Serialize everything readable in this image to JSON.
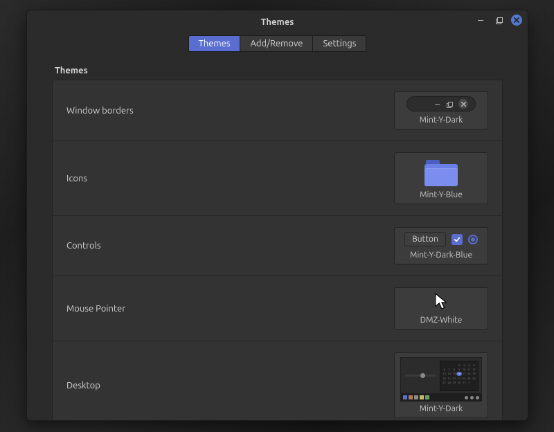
{
  "window": {
    "title": "Themes"
  },
  "tabs": [
    {
      "label": "Themes",
      "active": true
    },
    {
      "label": "Add/Remove",
      "active": false
    },
    {
      "label": "Settings",
      "active": false
    }
  ],
  "section": {
    "heading": "Themes"
  },
  "rows": {
    "window_borders": {
      "label": "Window borders",
      "value": "Mint-Y-Dark"
    },
    "icons": {
      "label": "Icons",
      "value": "Mint-Y-Blue"
    },
    "controls": {
      "label": "Controls",
      "value": "Mint-Y-Dark-Blue",
      "sample_button": "Button"
    },
    "mouse_pointer": {
      "label": "Mouse Pointer",
      "value": "DMZ-White"
    },
    "desktop": {
      "label": "Desktop",
      "value": "Mint-Y-Dark"
    }
  },
  "colors": {
    "accent": "#5a6dd0"
  }
}
